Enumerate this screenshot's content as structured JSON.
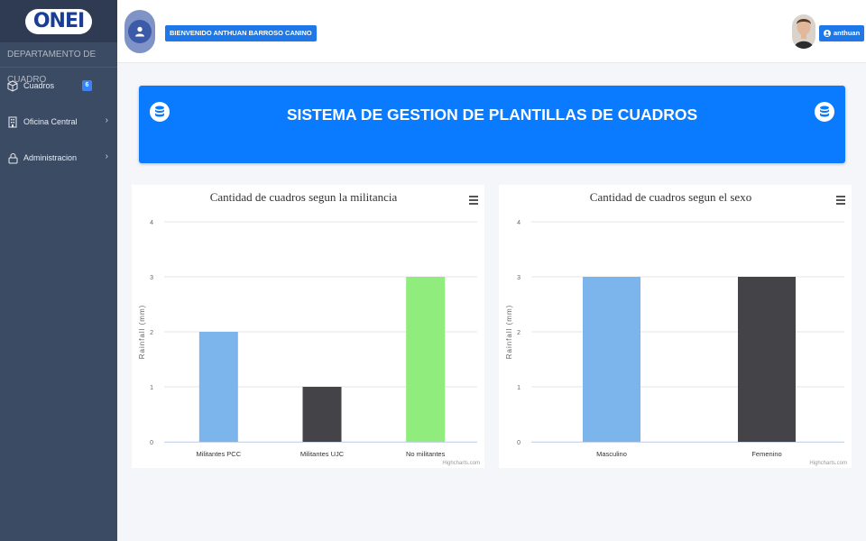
{
  "sidebar": {
    "logo": "ONEI",
    "department": "DEPARTAMENTO DE CUADRO",
    "items": [
      {
        "label": "Cuadros",
        "badge": "6",
        "icon": "box-icon"
      },
      {
        "label": "Oficina Central",
        "icon": "building-icon"
      },
      {
        "label": "Administracion",
        "icon": "lock-icon"
      }
    ]
  },
  "header": {
    "welcome": "BIENVENIDO ANTHUAN BARROSO CANINO",
    "username": "anthuan"
  },
  "banner": {
    "title": "SISTEMA DE GESTION DE PLANTILLAS DE CUADROS"
  },
  "colors": {
    "sidebar": "#3c4b64",
    "accent": "#0a7bff",
    "bar_blue": "#7cb5ec",
    "bar_dark": "#434348",
    "bar_green": "#90ed7d"
  },
  "chart_data": [
    {
      "type": "bar",
      "title": "Cantidad de cuadros segun la militancia",
      "xlabel": "",
      "ylabel": "Rainfall (mm)",
      "ylim": [
        0,
        4
      ],
      "yticks": [
        "0",
        "1",
        "2",
        "3",
        "4"
      ],
      "categories": [
        "Militantes PCC",
        "Militantes UJC",
        "No militantes"
      ],
      "values": [
        2,
        1,
        3
      ],
      "bar_colors": [
        "#7cb5ec",
        "#434348",
        "#90ed7d"
      ],
      "credits": "Highcharts.com",
      "grid": true
    },
    {
      "type": "bar",
      "title": "Cantidad de cuadros segun el sexo",
      "xlabel": "",
      "ylabel": "Rainfall (mm)",
      "ylim": [
        0,
        4
      ],
      "yticks": [
        "0",
        "1",
        "2",
        "3",
        "4"
      ],
      "categories": [
        "Masculino",
        "Femenino"
      ],
      "values": [
        3,
        3
      ],
      "bar_colors": [
        "#7cb5ec",
        "#434348"
      ],
      "credits": "Highcharts.com",
      "grid": true
    }
  ]
}
